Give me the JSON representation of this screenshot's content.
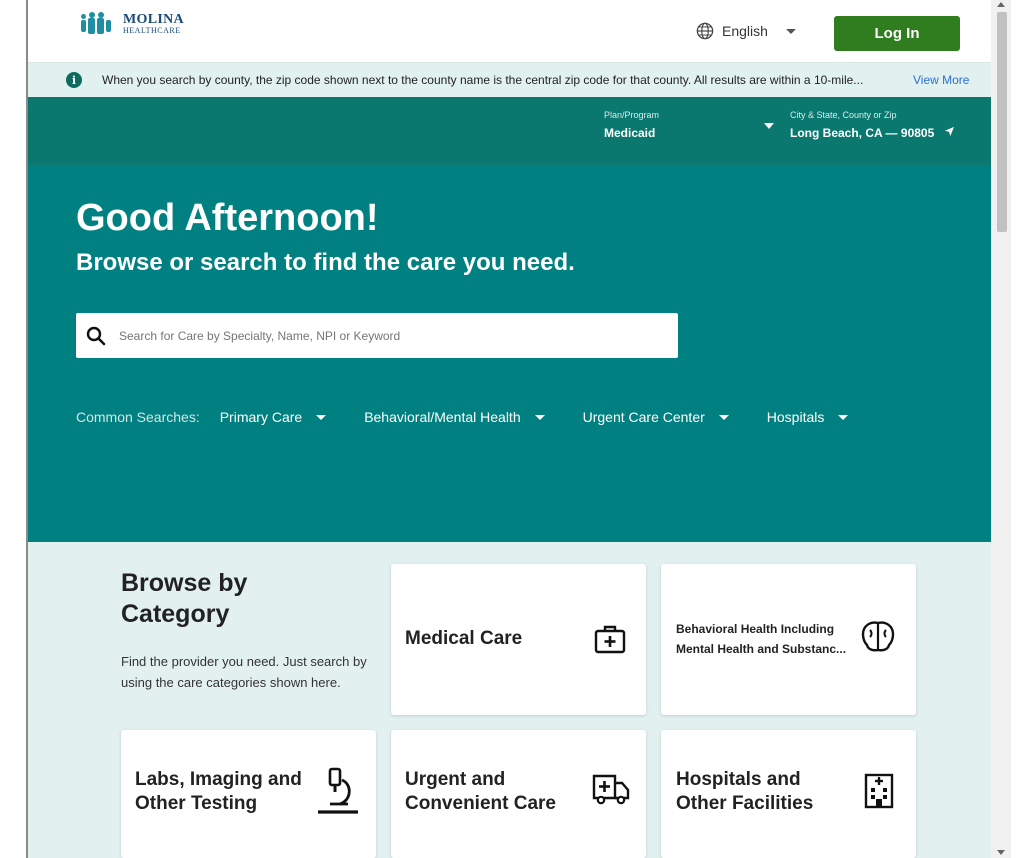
{
  "header": {
    "logo_line1": "MOLINA",
    "logo_line2": "HEALTHCARE",
    "language": "English",
    "login_label": "Log In"
  },
  "info": {
    "text": "When you search by county, the zip code shown next to the county name is the central zip code for that county. All results are within a 10-mile...",
    "view_more": "View More"
  },
  "filters": {
    "plan_label": "Plan/Program",
    "plan_value": "Medicaid",
    "location_label": "City & State, County or Zip",
    "location_value": "Long Beach, CA — 90805"
  },
  "hero": {
    "greeting": "Good Afternoon!",
    "subtitle": "Browse or search to find the care you need.",
    "search_placeholder": "Search for Care by Specialty, Name, NPI or Keyword",
    "common_label": "Common Searches:",
    "common_searches": [
      "Primary Care",
      "Behavioral/Mental Health",
      "Urgent Care Center",
      "Hospitals"
    ]
  },
  "browse": {
    "title": "Browse by Category",
    "description": "Find the provider you need. Just search by using the care categories shown here.",
    "categories": [
      {
        "label": "Medical Care",
        "icon": "first-aid-kit-icon"
      },
      {
        "label": "Behavioral Health Including Mental Health and Substanc...",
        "icon": "brain-icon"
      },
      {
        "label": "Labs, Imaging and Other Testing",
        "icon": "microscope-icon"
      },
      {
        "label": "Urgent and Convenient Care",
        "icon": "ambulance-icon"
      },
      {
        "label": "Hospitals and Other Facilities",
        "icon": "hospital-icon"
      }
    ]
  },
  "colors": {
    "teal_dark": "#0b7870",
    "teal_hero": "#008080",
    "login_green": "#2f7d1f",
    "info_bg": "#e1f1ef",
    "link_blue": "#2c6fd1"
  }
}
